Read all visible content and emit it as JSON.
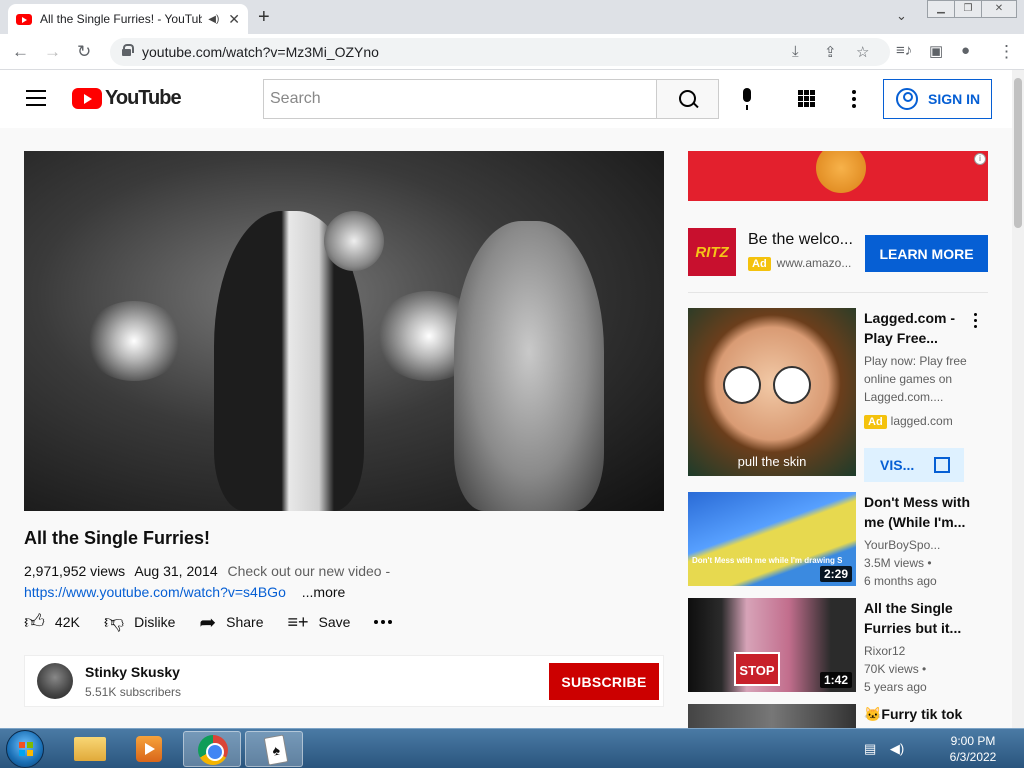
{
  "browser": {
    "tab_title": "All the Single Furries! - YouTube",
    "url": "youtube.com/watch?v=Mz3Mi_OZYno"
  },
  "youtube": {
    "logo_text": "YouTube",
    "search_placeholder": "Search",
    "sign_in_label": "SIGN IN"
  },
  "video": {
    "title": "All the Single Furries!",
    "views": "2,971,952 views",
    "date": "Aug 31, 2014",
    "description": "Check out our new video -",
    "link": "https://www.youtube.com/watch?v=s4BGo",
    "more_label": "...more",
    "actions": {
      "likes": "42K",
      "dislike_label": "Dislike",
      "share_label": "Share",
      "save_label": "Save"
    },
    "channel": {
      "name": "Stinky Skusky",
      "subscribers": "5.51K subscribers",
      "subscribe_label": "SUBSCRIBE"
    }
  },
  "sidebar": {
    "ad": {
      "brand_logo_text": "RITZ",
      "headline": "Be the welco...",
      "badge": "Ad",
      "domain": "www.amazo...",
      "cta": "LEARN MORE"
    },
    "recommendations": [
      {
        "title": "Lagged.com - Play Free...",
        "desc": "Play now: Play free online games on Lagged.com....",
        "badge": "Ad",
        "domain": "lagged.com",
        "cta": "VIS...",
        "thumb_caption": "pull the skin"
      },
      {
        "title": "Don't Mess with me (While I'm...",
        "channel": "YourBoySpo...",
        "views": "3.5M views •",
        "age": "6 months ago",
        "duration": "2:29",
        "thumb_caption": "Don't Mess with me while I'm drawing SPONGEBOB FREESTYLE"
      },
      {
        "title": "All the Single Furries but it...",
        "channel": "Rixor12",
        "views": "70K views •",
        "age": "5 years ago",
        "duration": "1:42",
        "thumb_caption": "STOP"
      },
      {
        "title": "🐱Furry tik tok"
      }
    ]
  },
  "taskbar": {
    "time": "9:00 PM",
    "date": "6/3/2022"
  }
}
